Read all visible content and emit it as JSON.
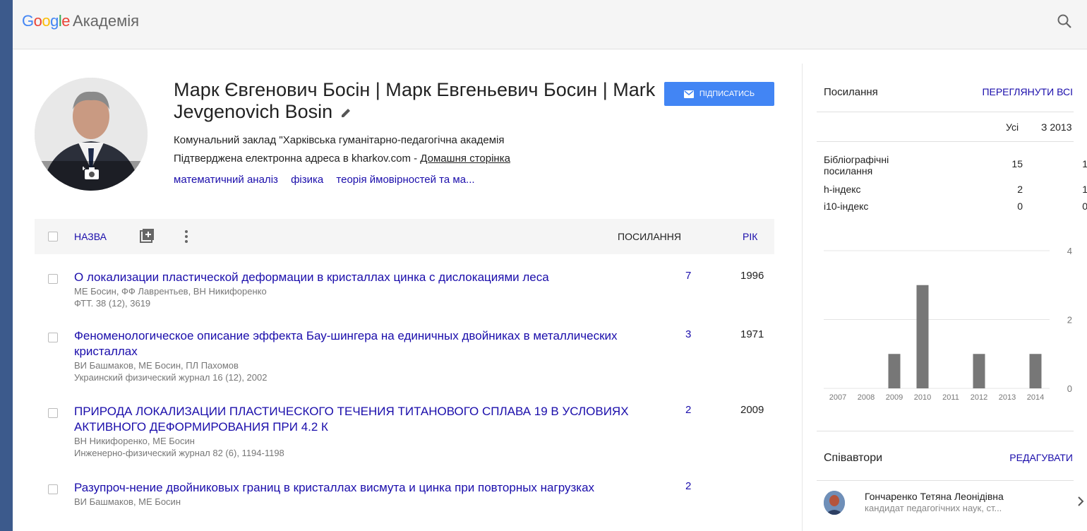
{
  "header": {
    "logo_text": "Google",
    "product": "Академія",
    "search_icon": "search-icon"
  },
  "profile": {
    "name": "Марк Євгенович Босін | Марк Евгеньевич Босин | Mark Jevgenovich Bosin",
    "affiliation": "Комунальний заклад \"Харківська гуманітарно-педагогічна академія",
    "email_text": "Підтверджена електронна адреса в kharkov.com - ",
    "homepage_label": "Домашня сторінка",
    "interests": [
      "математичний аналіз",
      "фізика",
      "теорія ймовірностей та ма..."
    ],
    "follow_label": "ПІДПИСАТИСЬ"
  },
  "table": {
    "col_title": "НАЗВА",
    "col_cites": "ПОСИЛАННЯ",
    "col_year": "РІК"
  },
  "articles": [
    {
      "title": "О локализации пластической деформации в кристаллах цинка с дислокациями леса",
      "authors": "МЕ Босин, ФФ Лаврентьев, ВН Никифоренко",
      "venue": "ФТТ. 38 (12), 3619",
      "cites": "7",
      "year": "1996"
    },
    {
      "title": "Феноменологическое описание эффекта Бау-шингера на единичных двойниках в металлических кристаллах",
      "authors": "ВИ Башмаков, МЕ Босин, ПЛ Пахомов",
      "venue": "Украинский физический журнал 16 (12), 2002",
      "cites": "3",
      "year": "1971"
    },
    {
      "title": "ПРИРОДА ЛОКАЛИЗАЦИИ ПЛАСТИЧЕСКОГО ТЕЧЕНИЯ ТИТАНОВОГО СПЛАВА 19 В УСЛОВИЯХ АКТИВНОГО ДЕФОРМИРОВАНИЯ ПРИ 4.2 К",
      "authors": "ВН Никифоренко, МЕ Босин",
      "venue": "Инженерно-физический журнал 82 (6), 1194-1198",
      "cites": "2",
      "year": "2009"
    },
    {
      "title": "Разупроч-нение двойниковых границ в кристаллах висмута и цинка при повторных нагрузках",
      "authors": "ВИ Башмаков, МЕ Босин",
      "venue": "",
      "cites": "2",
      "year": ""
    }
  ],
  "citations": {
    "title": "Посилання",
    "view_all": "ПЕРЕГЛЯНУТИ ВСІ",
    "col_all": "Усі",
    "col_since": "З 2013",
    "rows": [
      {
        "label": "Бібліографічні посилання",
        "all": "15",
        "since": "1"
      },
      {
        "label": "h-індекс",
        "all": "2",
        "since": "1"
      },
      {
        "label": "i10-індекс",
        "all": "0",
        "since": "0"
      }
    ]
  },
  "chart_data": {
    "type": "bar",
    "categories": [
      "2007",
      "2008",
      "2009",
      "2010",
      "2011",
      "2012",
      "2013",
      "2014"
    ],
    "values": [
      0,
      0,
      1,
      3,
      0,
      1,
      0,
      1
    ],
    "ylim": [
      0,
      4
    ],
    "yticks": [
      "4",
      "2",
      "0"
    ],
    "title": "",
    "xlabel": "",
    "ylabel": "",
    "bar_color": "#777777"
  },
  "coauthors": {
    "title": "Співавтори",
    "edit_label": "РЕДАГУВАТИ",
    "items": [
      {
        "name": "Гончаренко Тетяна Леонідівна",
        "desc": "кандидат педагогічних наук, ст..."
      }
    ]
  },
  "colors": {
    "link": "#1a0dab",
    "accent": "#4285f4",
    "background": "#3c5a8c"
  }
}
